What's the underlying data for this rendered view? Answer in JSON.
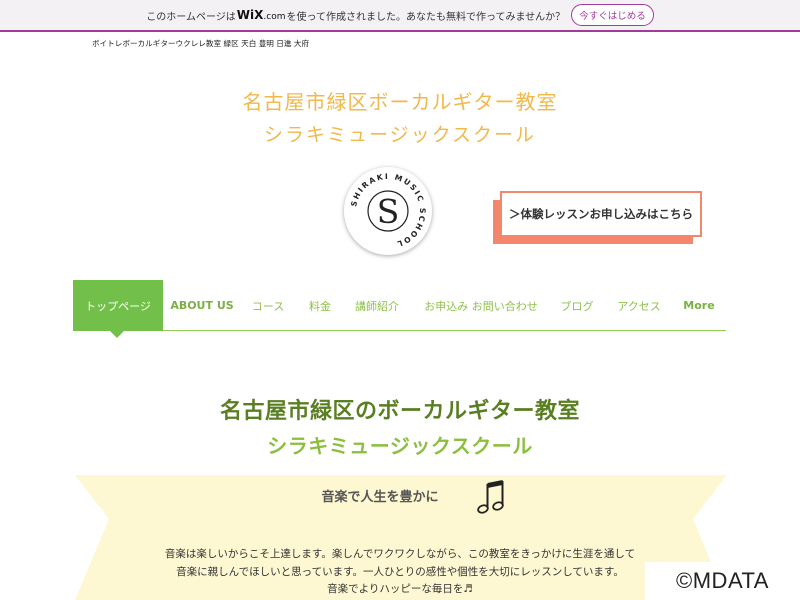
{
  "wix_banner": {
    "text_before": "このホームページは",
    "logo_main": "WiX",
    "logo_suffix": ".com",
    "text_after": "を使って作成されました。あなたも無料で作ってみませんか？",
    "button_label": "今すぐはじめる"
  },
  "breadcrumb": "ボイトレボーカルギターウクレレ教室 緑区 天白 豊明 日進 大府",
  "site_title": {
    "line1": "名古屋市緑区ボーカルギター教室",
    "line2": "シラキミュージックスクール"
  },
  "logo": {
    "letter": "S",
    "ring_text": "SHIRAKI MUSIC SCHOOL"
  },
  "cta": {
    "label": "＞体験レッスンお申し込みはこちら"
  },
  "nav": {
    "items": [
      {
        "label": "トップページ"
      },
      {
        "label": "ABOUT US"
      },
      {
        "label": "コース"
      },
      {
        "label": "料金"
      },
      {
        "label": "講師紹介"
      },
      {
        "label": "お申込み お問い合わせ"
      },
      {
        "label": "ブログ"
      },
      {
        "label": "アクセス"
      },
      {
        "label": "More"
      }
    ]
  },
  "main": {
    "heading1": "名古屋市緑区のボーカルギター教室",
    "heading2": "シラキミュージックスクール",
    "catchphrase": "音楽で人生を豊かに",
    "body": [
      "音楽は楽しいからこそ上達します。楽しんでワクワクしながら、この教室をきっかけに生涯を通して",
      "音楽に親しんでほしいと思っています。一人ひとりの感性や個性を大切にレッスンしています。",
      "音楽でよりハッピーな毎日を♬"
    ]
  },
  "watermark": "©MDATA",
  "colors": {
    "wix_accent": "#a23a9a",
    "title_gold": "#f0b94c",
    "nav_green": "#72c04a",
    "heading_dark_green": "#5a7f23",
    "heading_light_green": "#8cbf3f",
    "cta_orange": "#f4876b",
    "ribbon_yellow": "#fdf7d2"
  },
  "icons": {
    "music_note": "eighth-notes-icon"
  }
}
